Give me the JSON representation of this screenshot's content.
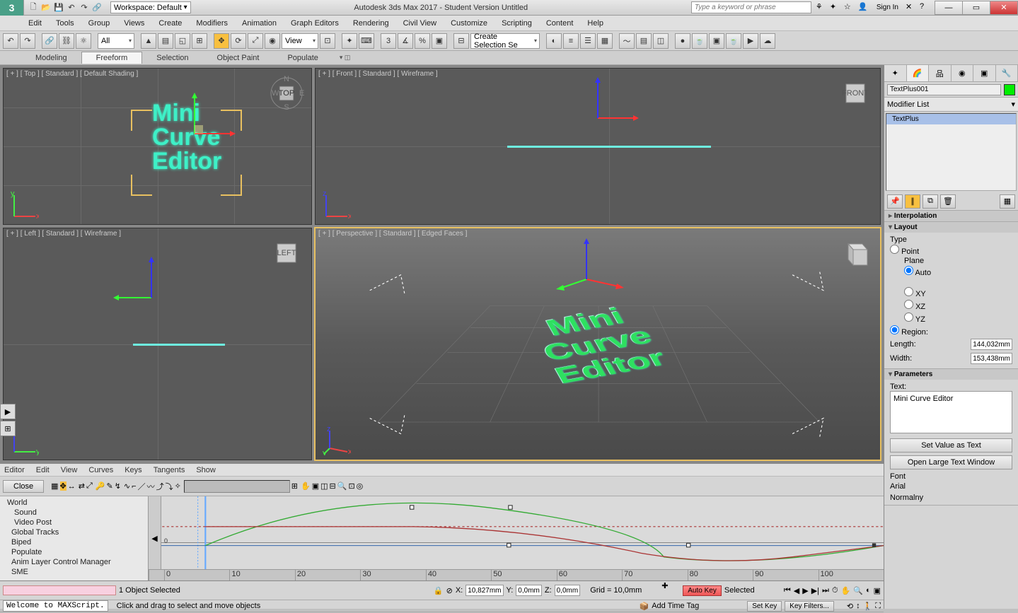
{
  "title": "Autodesk 3ds Max 2017 - Student Version    Untitled",
  "workspace_label": "Workspace: Default",
  "search_placeholder": "Type a keyword or phrase",
  "signin": "Sign In",
  "menu": [
    "Edit",
    "Tools",
    "Group",
    "Views",
    "Create",
    "Modifiers",
    "Animation",
    "Graph Editors",
    "Rendering",
    "Civil View",
    "Customize",
    "Scripting",
    "Content",
    "Help"
  ],
  "toolbar": {
    "filter_all": "All",
    "view_label": "View",
    "named_set": "Create Selection Se"
  },
  "ribbon": [
    "Modeling",
    "Freeform",
    "Selection",
    "Object Paint",
    "Populate"
  ],
  "viewports": {
    "top": "[ + ] [ Top ] [ Standard ] [ Default Shading ]",
    "front": "[ + ] [ Front ] [ Standard ] [ Wireframe ]",
    "left": "[ + ] [ Left ] [ Standard ] [ Wireframe ]",
    "persp": "[ + ] [ Perspective ] [ Standard ] [ Edged Faces ]"
  },
  "viewport_text": "Mini\nCurve\nEditor",
  "curve_editor": {
    "menu": [
      "Editor",
      "Edit",
      "View",
      "Curves",
      "Keys",
      "Tangents",
      "Show"
    ],
    "close": "Close",
    "tree": [
      "World",
      "Sound",
      "Video Post",
      "Global Tracks",
      "Biped",
      "Populate",
      "Anim Layer Control Manager",
      "SME"
    ],
    "ruler": [
      "0",
      "10",
      "20",
      "30",
      "40",
      "50",
      "60",
      "70",
      "80",
      "90",
      "100"
    ]
  },
  "status": {
    "selected": "1 Object Selected",
    "hint": "Click and drag to select and move objects",
    "welcome": "Welcome to MAXScript.",
    "x": "10,827mm",
    "y": "0,0mm",
    "z": "0,0mm",
    "grid": "Grid = 10,0mm",
    "add_time_tag": "Add Time Tag",
    "auto_key": "Auto Key",
    "set_key": "Set Key",
    "selected_drop": "Selected",
    "key_filters": "Key Filters..."
  },
  "right": {
    "object_name": "TextPlus001",
    "modlist": "Modifier List",
    "stack_item": "TextPlus",
    "rollouts": {
      "interp": "Interpolation",
      "layout": "Layout",
      "params": "Parameters"
    },
    "layout": {
      "type_label": "Type",
      "point": "Point",
      "plane": "Plane",
      "auto": "Auto",
      "xy": "XY",
      "xz": "XZ",
      "yz": "YZ",
      "region": "Region:",
      "length_label": "Length:",
      "length_val": "144,032mm",
      "width_label": "Width:",
      "width_val": "153,438mm"
    },
    "params": {
      "text_label": "Text:",
      "text_value": "Mini Curve Editor",
      "set_value": "Set Value as Text",
      "open_large": "Open Large Text Window",
      "font_label": "Font",
      "font_name": "Arial",
      "font_style": "Normalny"
    }
  }
}
